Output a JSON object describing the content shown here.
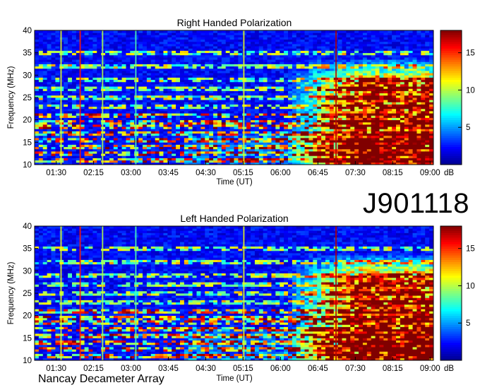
{
  "observation_id": "J901118",
  "instrument": "Nancay Decameter Array",
  "colors": {
    "colormap": [
      "#00008f",
      "#0000ff",
      "#0080ff",
      "#00ffff",
      "#80ff80",
      "#ffff00",
      "#ff8000",
      "#ff0000",
      "#800000"
    ]
  },
  "chart_data": [
    {
      "type": "heatmap",
      "title": "Right Handed Polarization",
      "xlabel": "Time (UT)",
      "ylabel": "Frequency (MHz)",
      "x_ticks": [
        "01:30",
        "02:15",
        "03:00",
        "03:45",
        "04:30",
        "05:15",
        "06:00",
        "06:45",
        "07:30",
        "08:15",
        "09:00"
      ],
      "y_ticks": [
        10,
        15,
        20,
        25,
        30,
        35,
        40
      ],
      "xlim": [
        "01:04",
        "09:04"
      ],
      "ylim": [
        10,
        40
      ],
      "colorbar": {
        "label": "dB",
        "ticks": [
          5,
          10,
          15
        ],
        "range": [
          0,
          18
        ]
      },
      "features": {
        "background_level_db": 1,
        "strong_emission_onset": "06:05",
        "strong_emission_freq_range": [
          10,
          28
        ],
        "vertical_interference": [
          "01:35",
          "01:58",
          "02:25",
          "03:05",
          "05:15",
          "07:06"
        ]
      }
    },
    {
      "type": "heatmap",
      "title": "Left Handed Polarization",
      "xlabel": "Time (UT)",
      "ylabel": "Frequency (MHz)",
      "x_ticks": [
        "01:30",
        "02:15",
        "03:00",
        "03:45",
        "04:30",
        "05:15",
        "06:00",
        "06:45",
        "07:30",
        "08:15",
        "09:00"
      ],
      "y_ticks": [
        10,
        15,
        20,
        25,
        30,
        35,
        40
      ],
      "xlim": [
        "01:04",
        "09:04"
      ],
      "ylim": [
        10,
        40
      ],
      "colorbar": {
        "label": "dB",
        "ticks": [
          5,
          10,
          15
        ],
        "range": [
          0,
          18
        ]
      },
      "features": {
        "background_level_db": 1,
        "strong_emission_onset": "06:05",
        "strong_emission_freq_range": [
          10,
          28
        ],
        "vertical_interference": [
          "01:35",
          "01:58",
          "02:25",
          "03:05",
          "05:15",
          "07:06"
        ]
      }
    }
  ]
}
